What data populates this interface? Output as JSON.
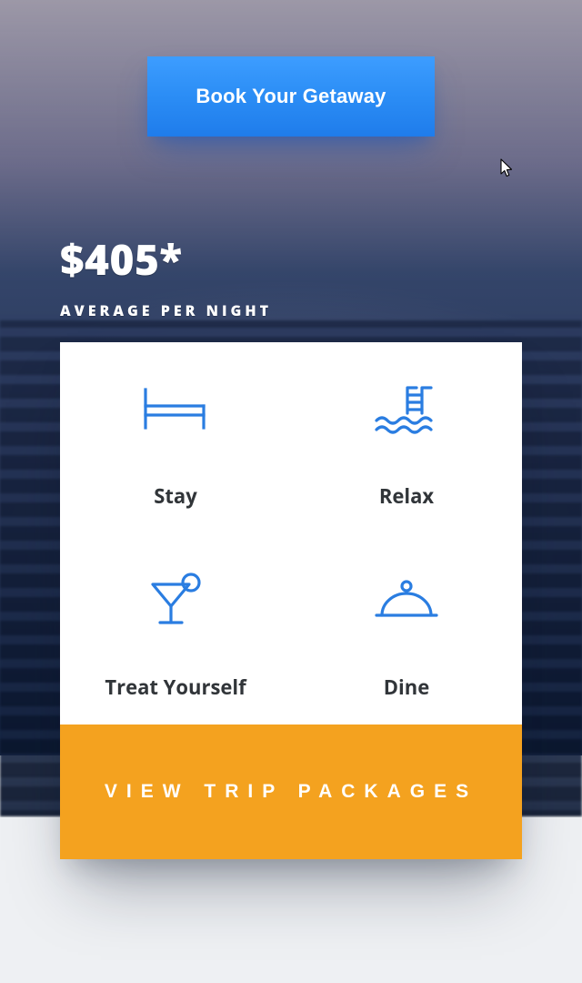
{
  "hero": {
    "cta_label": "Book Your Getaway",
    "price": "$405*",
    "price_caption": "AVERAGE PER NIGHT"
  },
  "features": [
    {
      "icon": "bed-icon",
      "label": "Stay"
    },
    {
      "icon": "pool-icon",
      "label": "Relax"
    },
    {
      "icon": "cocktail-icon",
      "label": "Treat Yourself"
    },
    {
      "icon": "cloche-icon",
      "label": "Dine"
    }
  ],
  "packages_cta": "VIEW TRIP PACKAGES",
  "colors": {
    "blue": "#2a7de1",
    "orange": "#f4a21f"
  }
}
